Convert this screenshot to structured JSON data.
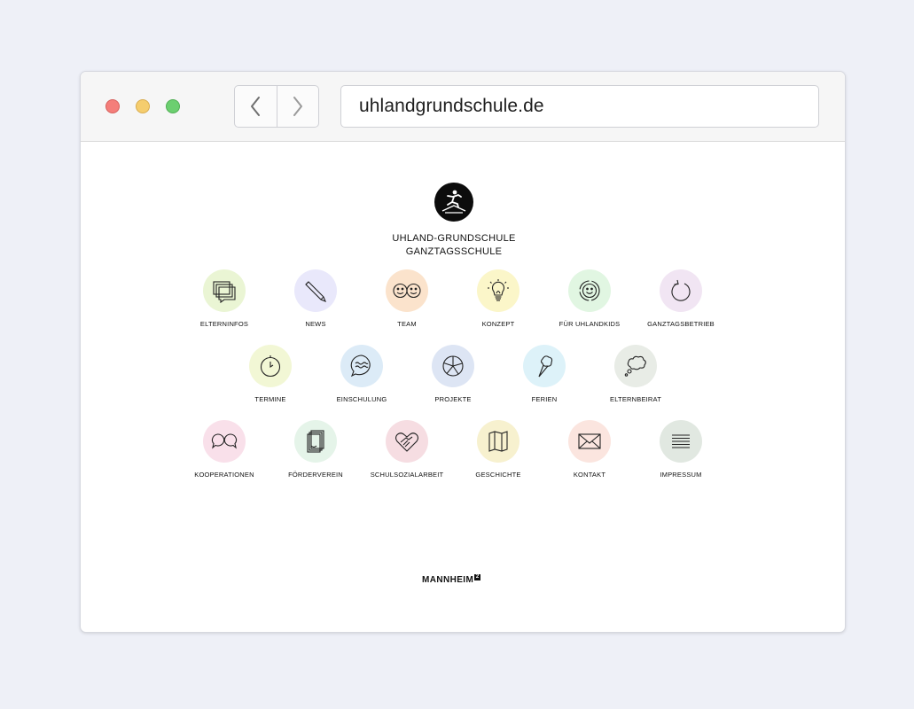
{
  "browser": {
    "url": "uhlandgrundschule.de",
    "nav": {
      "back_icon": "chevron-left-icon",
      "forward_icon": "chevron-right-icon"
    }
  },
  "school": {
    "name_line1": "UHLAND-GRUNDSCHULE",
    "name_line2": "GANZTAGSSCHULE"
  },
  "menu": [
    {
      "label": "ELTERNINFOS",
      "icon": "chat-stack-icon",
      "color": "#eaf5d4"
    },
    {
      "label": "NEWS",
      "icon": "pencil-icon",
      "color": "#e9e8fb"
    },
    {
      "label": "TEAM",
      "icon": "two-faces-icon",
      "color": "#fbe3cc"
    },
    {
      "label": "KONZEPT",
      "icon": "lightbulb-icon",
      "color": "#fbf6c9"
    },
    {
      "label": "FÜR UHLANDKIDS",
      "icon": "smiley-icon",
      "color": "#e1f6e2"
    },
    {
      "label": "GANZTAGSBETRIEB",
      "icon": "refresh-circle-icon",
      "color": "#f1e5f3"
    },
    {
      "label": "TERMINE",
      "icon": "clock-icon",
      "color": "#f2f7d5"
    },
    {
      "label": "EINSCHULUNG",
      "icon": "speech-bubble-icon",
      "color": "#dcebf7"
    },
    {
      "label": "PROJEKTE",
      "icon": "pie-wheel-icon",
      "color": "#dde5f4"
    },
    {
      "label": "FERIEN",
      "icon": "ice-cream-icon",
      "color": "#ddf2f9"
    },
    {
      "label": "ELTERNBEIRAT",
      "icon": "thought-bubble-icon",
      "color": "#e8ece6"
    },
    {
      "label": "KOOPERATIONEN",
      "icon": "dialog-bubbles-icon",
      "color": "#f9e0ea"
    },
    {
      "label": "FÖRDERVEREIN",
      "icon": "document-stack-icon",
      "color": "#e5f4e9"
    },
    {
      "label": "SCHULSOZIALARBEIT",
      "icon": "heart-hands-icon",
      "color": "#f6dde2"
    },
    {
      "label": "GESCHICHTE",
      "icon": "map-icon",
      "color": "#f7f1cf"
    },
    {
      "label": "KONTAKT",
      "icon": "envelope-icon",
      "color": "#fbe5df"
    },
    {
      "label": "IMPRESSUM",
      "icon": "lines-icon",
      "color": "#e1e8e1"
    }
  ],
  "footer": {
    "city": "MANNHEIM",
    "city_sup": "2"
  }
}
